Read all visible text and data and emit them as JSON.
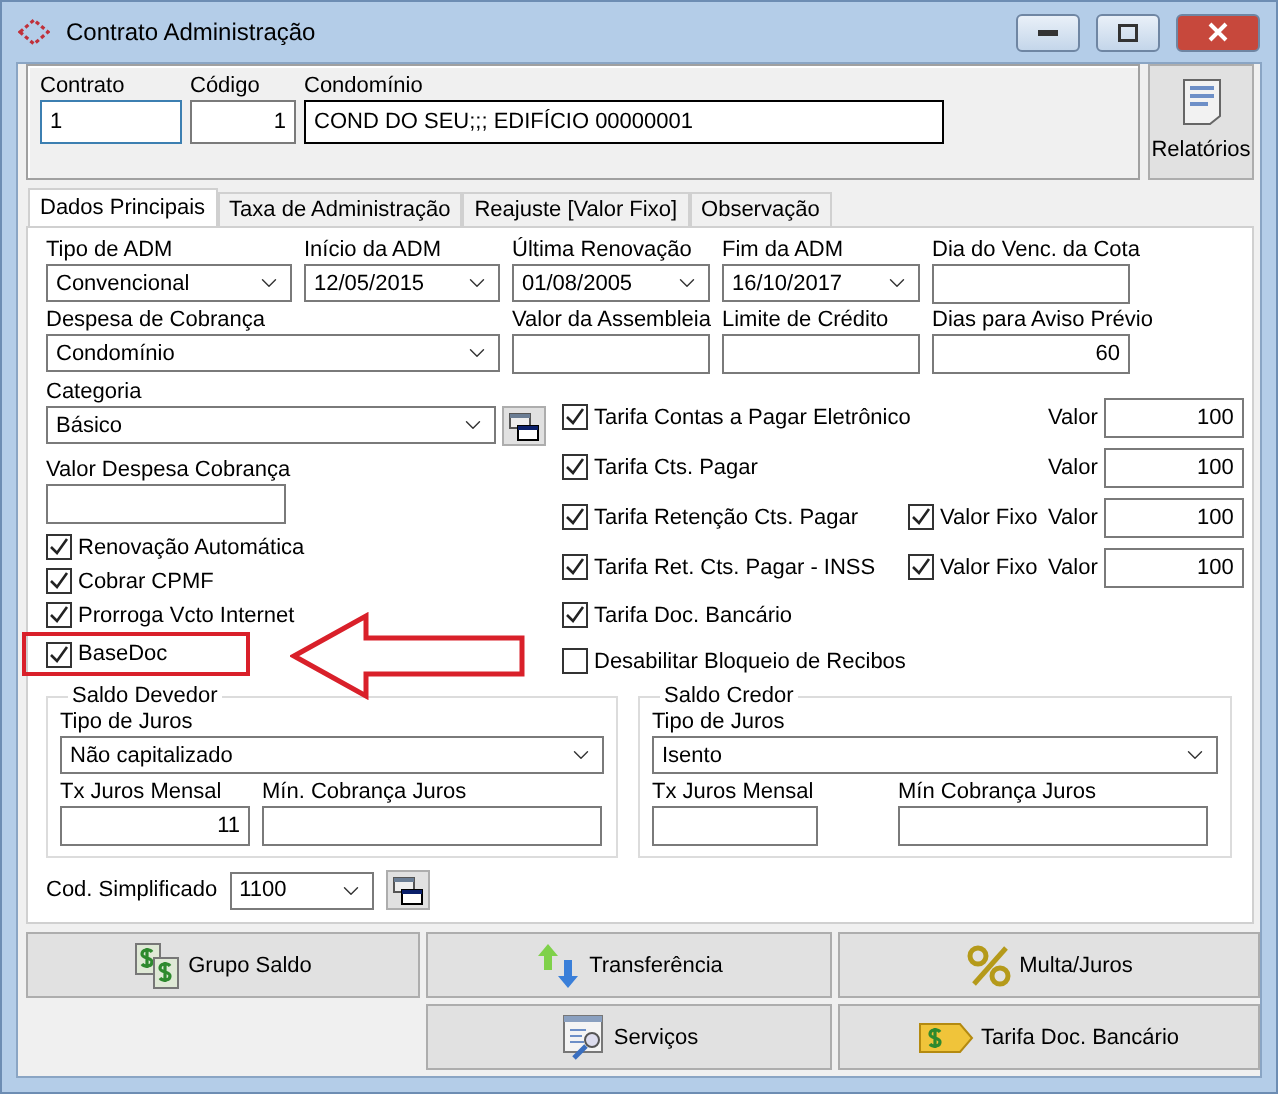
{
  "window": {
    "title": "Contrato Administração"
  },
  "header": {
    "fields": [
      {
        "label": "Contrato",
        "value": "1",
        "kind": "text",
        "focused": true
      },
      {
        "label": "Código",
        "value": "1",
        "kind": "number",
        "focused": false
      },
      {
        "label": "Condomínio",
        "value": "COND DO SEU;;; EDIFÍCIO 00000001",
        "kind": "wide",
        "focused": false
      }
    ],
    "report_button": {
      "label": "Relatórios"
    }
  },
  "tabs": [
    {
      "label": "Dados Principais",
      "selected": true
    },
    {
      "label": "Taxa de Administração",
      "selected": false
    },
    {
      "label": "Reajuste [Valor Fixo]",
      "selected": false
    },
    {
      "label": "Observação",
      "selected": false
    }
  ],
  "top_rows": [
    [
      {
        "label": "Tipo de ADM",
        "value": "Convencional",
        "kind": "combo"
      },
      {
        "label": "Início da ADM",
        "value": "12/05/2015",
        "kind": "combo"
      },
      {
        "label": "Última Renovação",
        "value": "01/08/2005",
        "kind": "combo"
      },
      {
        "label": "Fim da ADM",
        "value": "16/10/2017",
        "kind": "combo"
      },
      {
        "label": "Dia do Venc. da Cota",
        "kind": "text"
      }
    ],
    [
      {
        "label": "Despesa de Cobrança",
        "value": "Condomínio",
        "kind": "combo"
      },
      {
        "label": "Valor da Assembleia",
        "kind": "text"
      },
      {
        "label": "Limite de Crédito",
        "kind": "text"
      },
      {
        "label": "Dias para Aviso Prévio",
        "value": "60",
        "kind": "number"
      }
    ]
  ],
  "categoria": {
    "label": "Categoria",
    "value": "Básico"
  },
  "valor_despesa": {
    "label": "Valor Despesa Cobrança"
  },
  "options": [
    {
      "label": "Renovação Automática",
      "checked": true,
      "highlighted": false
    },
    {
      "label": "Cobrar CPMF",
      "checked": true,
      "highlighted": false
    },
    {
      "label": "Prorroga Vcto Internet",
      "checked": true,
      "highlighted": false
    },
    {
      "label": "BaseDoc",
      "checked": true,
      "highlighted": true
    }
  ],
  "tarifas": [
    {
      "label": "Tarifa Contas a Pagar Eletrônico",
      "checked": true,
      "valor_label": "Valor",
      "valor": "100"
    },
    {
      "label": "Tarifa Cts. Pagar",
      "checked": true,
      "valor_label": "Valor",
      "valor": "100"
    },
    {
      "label": "Tarifa Retenção Cts. Pagar",
      "checked": true,
      "valor_fixo": {
        "label": "Valor Fixo",
        "checked": true
      },
      "valor_label": "Valor",
      "valor": "100"
    },
    {
      "label": "Tarifa Ret. Cts. Pagar - INSS",
      "checked": true,
      "valor_fixo": {
        "label": "Valor Fixo",
        "checked": true
      },
      "valor_label": "Valor",
      "valor": "100"
    },
    {
      "label": "Tarifa Doc. Bancário",
      "checked": true
    },
    {
      "label": "Desabilitar Bloqueio de Recibos",
      "checked": false
    }
  ],
  "saldo_groups": [
    {
      "title": "Saldo Devedor",
      "tipo_label": "Tipo de Juros",
      "tipo_value": "Não capitalizado",
      "tx_label": "Tx Juros Mensal",
      "tx_value": "11",
      "min_label": "Mín. Cobrança Juros"
    },
    {
      "title": "Saldo Credor",
      "tipo_label": "Tipo de Juros",
      "tipo_value": "Isento",
      "tx_label": "Tx Juros Mensal",
      "min_label": "Mín Cobrança Juros"
    }
  ],
  "cod_simplificado": {
    "label": "Cod. Simplificado",
    "value": "1100"
  },
  "actions": [
    [
      {
        "label": "Grupo Saldo",
        "kind": "money"
      },
      {
        "label": "Transferência",
        "kind": "transfer"
      },
      {
        "label": "Multa/Juros",
        "kind": "percent"
      }
    ],
    [
      {
        "label": "Serviços",
        "kind": "services"
      },
      {
        "label": "Tarifa Doc. Bancário",
        "kind": "tag"
      }
    ]
  ]
}
